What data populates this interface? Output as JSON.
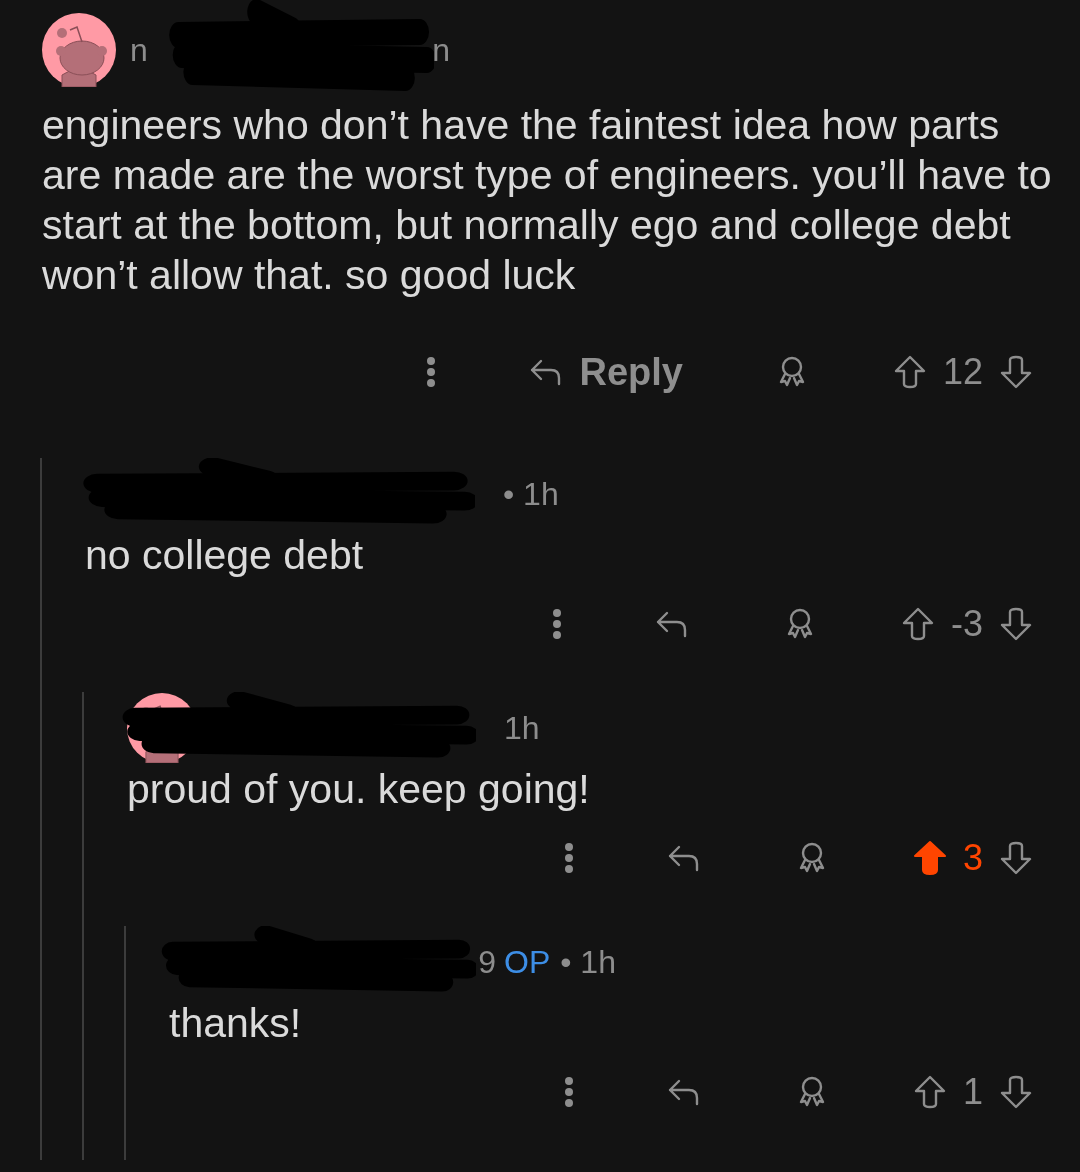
{
  "comment": {
    "avatar": true,
    "redacted": true,
    "header": [
      {
        "text": "n",
        "kind": "name"
      },
      {
        "text": "n",
        "kind": "name"
      }
    ],
    "body": "engineers who don’t have the faintest idea how parts are made are the worst type of engineers. you’ll have to start at the bottom, but normally ego and college debt won’t allow that. so good luck",
    "actions": {
      "reply_label": "Reply",
      "score": "12",
      "upvoted": false
    },
    "children": [
      {
        "redacted": true,
        "header": [
          {
            "text": "• 1h",
            "kind": "meta"
          }
        ],
        "body": "no college debt",
        "actions": {
          "score": "-3",
          "upvoted": false
        },
        "children": [
          {
            "avatar": true,
            "redacted": true,
            "header": [
              {
                "text": "1h",
                "kind": "meta"
              }
            ],
            "body": "proud of you. keep going!",
            "actions": {
              "score": "3",
              "upvoted": true
            },
            "children": [
              {
                "redacted": true,
                "header": [
                  {
                    "text": "9",
                    "kind": "name"
                  },
                  {
                    "text": "OP",
                    "kind": "op"
                  },
                  {
                    "text": "• 1h",
                    "kind": "meta"
                  }
                ],
                "body": "thanks!",
                "actions": {
                  "score": "1",
                  "upvoted": false
                }
              }
            ]
          }
        ]
      }
    ]
  }
}
